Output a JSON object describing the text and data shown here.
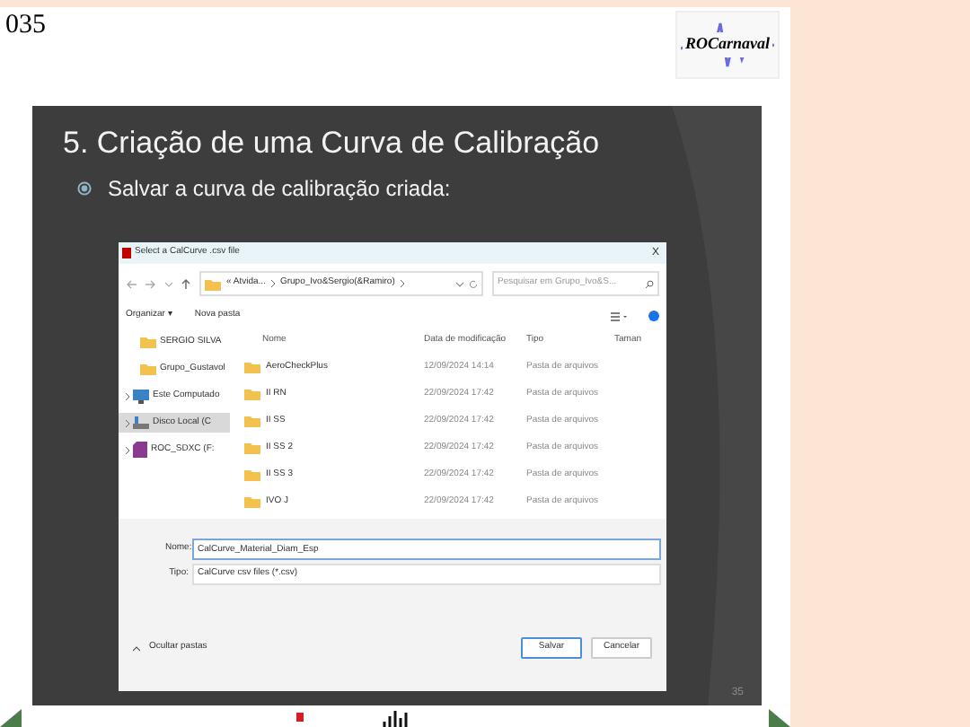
{
  "page": {
    "number": "035",
    "logo_text": "ROCarnaval"
  },
  "slide": {
    "title": "5. Criação de uma Curva de Calibração",
    "bullet": "Salvar a curva de calibração criada:",
    "slide_number": "35"
  },
  "dialog": {
    "title": "Select a CalCurve .csv file",
    "close": "X",
    "address": {
      "parts": [
        "« Atvida...",
        "Grupo_Ivo&Sergio(&Ramiro)"
      ]
    },
    "search": {
      "placeholder": "Pesquisar em Grupo_Ivo&S..."
    },
    "toolbar": {
      "organize": "Organizar ▾",
      "new_folder": "Nova pasta"
    },
    "nav": [
      {
        "label": "SERGIO SILVA",
        "kind": "folder",
        "selected": false
      },
      {
        "label": "Grupo_Gustavol",
        "kind": "folder",
        "selected": false
      },
      {
        "label": "Este Computado",
        "kind": "computer",
        "selected": false
      },
      {
        "label": "Disco Local (C",
        "kind": "drive",
        "selected": true
      },
      {
        "label": "ROC_SDXC (F:",
        "kind": "sdcard",
        "selected": false
      }
    ],
    "columns": [
      "Nome",
      "Data de modificação",
      "Tipo",
      "Taman"
    ],
    "rows": [
      {
        "name": "AeroCheckPlus",
        "date": "12/09/2024 14:14",
        "type": "Pasta de arquivos"
      },
      {
        "name": "II RN",
        "date": "22/09/2024 17:42",
        "type": "Pasta de arquivos"
      },
      {
        "name": "II SS",
        "date": "22/09/2024 17:42",
        "type": "Pasta de arquivos"
      },
      {
        "name": "II SS 2",
        "date": "22/09/2024 17:42",
        "type": "Pasta de arquivos"
      },
      {
        "name": "II SS 3",
        "date": "22/09/2024 17:42",
        "type": "Pasta de arquivos"
      },
      {
        "name": "IVO J",
        "date": "22/09/2024 17:42",
        "type": "Pasta de arquivos"
      }
    ],
    "filename": {
      "label": "Nome:",
      "value": "CalCurve_Material_Diam_Esp"
    },
    "filetype": {
      "label": "Tipo:",
      "value": "CalCurve csv files (*.csv)"
    },
    "hide_folders": "Ocultar pastas",
    "buttons": [
      "Salvar",
      "Cancelar"
    ]
  }
}
